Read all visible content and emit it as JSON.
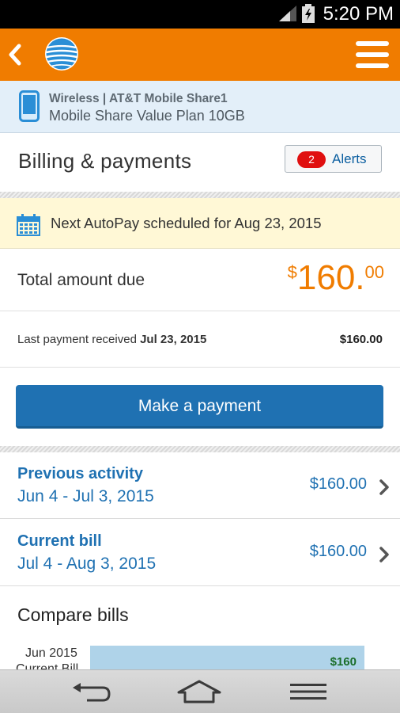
{
  "status_bar": {
    "time": "5:20 PM"
  },
  "app_bar": {
    "brand": "AT&T"
  },
  "account": {
    "line1": "Wireless | AT&T Mobile Share1",
    "line2": "Mobile Share Value Plan 10GB"
  },
  "billing": {
    "title": "Billing & payments",
    "alerts_count": "2",
    "alerts_label": "Alerts"
  },
  "autopay": {
    "text": "Next AutoPay scheduled for Aug 23, 2015"
  },
  "total": {
    "label": "Total amount due",
    "currency": "$",
    "dollars": "160.",
    "cents": "00"
  },
  "last_payment": {
    "label": "Last payment received ",
    "date": "Jul 23, 2015",
    "amount": "$160.00"
  },
  "pay_button": {
    "label": "Make a payment"
  },
  "previous_activity": {
    "title": "Previous activity",
    "dates": "Jun 4 - Jul 3, 2015",
    "amount": "$160.00"
  },
  "current_bill": {
    "title": "Current bill",
    "dates": "Jul 4 - Aug 3, 2015",
    "amount": "$160.00"
  },
  "compare": {
    "title": "Compare bills",
    "row1_label": "Jun 2015",
    "row2_label": "Current Bill",
    "row1_value": "$160"
  },
  "colors": {
    "brand_orange": "#f07c00",
    "link_blue": "#1f71b2",
    "alert_red": "#e01010",
    "autopay_bg": "#fff8d6"
  },
  "icons": [
    "signal-icon",
    "battery-charging-icon",
    "back-chevron-icon",
    "att-globe-logo",
    "hamburger-menu-icon",
    "phone-icon",
    "calendar-icon",
    "chevron-right-icon",
    "nav-back-icon",
    "nav-home-icon",
    "nav-recent-apps-icon"
  ]
}
